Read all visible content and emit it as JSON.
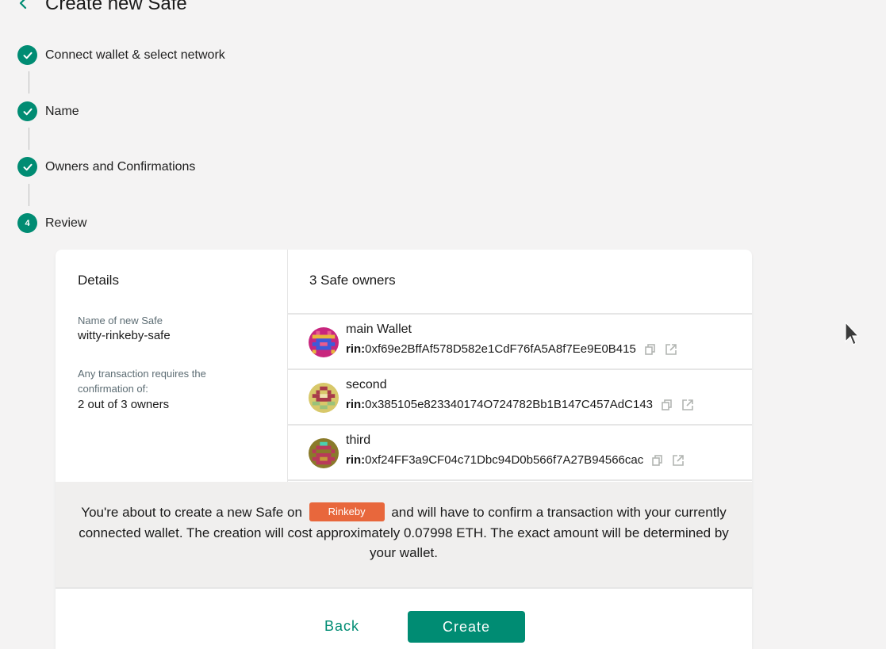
{
  "header": {
    "title": "Create new Safe",
    "back_icon": "chevron-left-icon"
  },
  "steps": [
    {
      "label": "Connect wallet & select network",
      "status": "complete"
    },
    {
      "label": "Name",
      "status": "complete"
    },
    {
      "label": "Owners and Confirmations",
      "status": "complete"
    },
    {
      "label": "Review",
      "number": "4",
      "status": "active"
    }
  ],
  "details": {
    "heading": "Details",
    "name_label": "Name of new Safe",
    "name_value": "witty-rinkeby-safe",
    "threshold_label": "Any transaction requires the confirmation of:",
    "threshold_value": "2 out of 3 owners"
  },
  "owners": {
    "heading": "3 Safe owners",
    "list": [
      {
        "name": "main Wallet",
        "prefix": "rin:",
        "address": "0xf69e2BffAf578D582e1CdF76fA5A8f7Ee9E0B415"
      },
      {
        "name": "second",
        "prefix": "rin:",
        "address": "0x385105e823340174O724782Bb1B147C457AdC143"
      },
      {
        "name": "third",
        "prefix": "rin:",
        "address": "0xf24FF3a9CF04c71Dbc94D0b566f7A27B94566cac"
      }
    ]
  },
  "info": {
    "before": "You're about to create a new Safe on",
    "network": "Rinkeby",
    "after": "and will have to confirm a transaction with your currently connected wallet. The creation will cost approximately 0.07998 ETH. The exact amount will be determined by your wallet."
  },
  "actions": {
    "back_label": "Back",
    "create_label": "Create"
  },
  "colors": {
    "accent": "#008c73",
    "network_badge": "#e8673c",
    "background": "#f4f3f3"
  }
}
